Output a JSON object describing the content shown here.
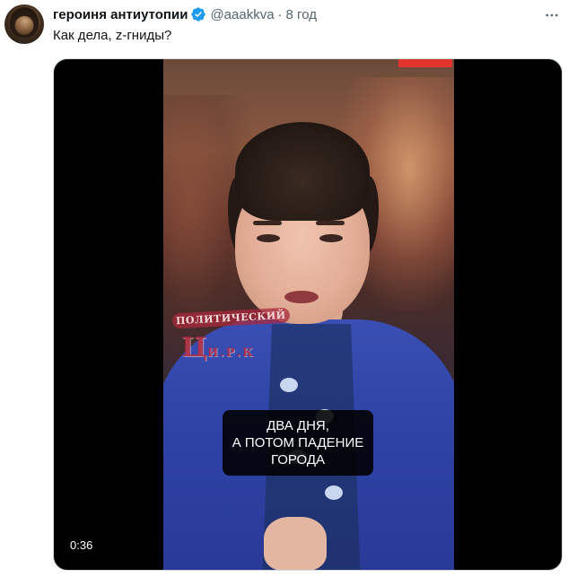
{
  "tweet": {
    "author_name": "героиня антиутопии",
    "handle": "@aaakkva",
    "separator": "·",
    "time": "8 год",
    "text": "Как дела, z-гниды?"
  },
  "media": {
    "watermark": {
      "line1": "ПОЛИТИЧЕСКИЙ",
      "line2_big": "Ц",
      "line2_small": "И.Р.К"
    },
    "caption_lines": [
      "ДВА ДНЯ,",
      "А ПОТОМ ПАДЕНИЕ",
      "ГОРОДА"
    ],
    "duration": "0:36"
  },
  "icons": {
    "verified": "verified-badge-icon",
    "more": "more-options-icon"
  },
  "colors": {
    "text_primary": "#0f1419",
    "text_secondary": "#536471",
    "verified_blue": "#1d9bf0",
    "media_background": "#000000"
  }
}
